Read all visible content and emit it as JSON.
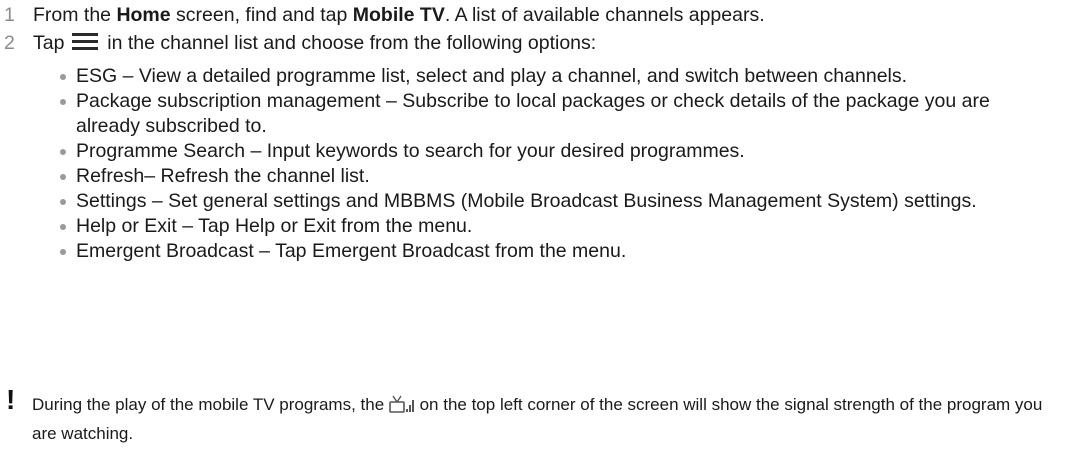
{
  "step1": {
    "number": "1",
    "text_a": "From the ",
    "bold_home": "Home",
    "text_b": " screen, find and tap ",
    "bold_app": "Mobile TV",
    "text_c": ". A list of available channels appears."
  },
  "step2": {
    "number": "2",
    "text_a": "Tap",
    "icon": "menu-icon",
    "text_b": "in the channel list and choose from the following options:"
  },
  "options": [
    {
      "text": "ESG – View a detailed programme list, select and play a channel, and switch between channels."
    },
    {
      "text": "Package subscription management – Subscribe to local packages or check details of the package you are already subscribed to."
    },
    {
      "text": "Programme Search – Input keywords to search for your desired programmes."
    },
    {
      "text": "Refresh– Refresh the channel list."
    },
    {
      "text": "Settings – Set general settings and MBBMS (Mobile Broadcast Business Management System) settings."
    },
    {
      "text": "Help or Exit – Tap Help or Exit from the menu."
    },
    {
      "text": "Emergent Broadcast – Tap Emergent Broadcast from the menu."
    }
  ],
  "note": {
    "icon": "exclamation-icon",
    "symbol": "!",
    "text_a": "During the play of the mobile TV programs, the ",
    "status_icon": "tv-signal-icon",
    "text_b": " on the top left corner of the screen will show the signal strength of the program you are watching."
  }
}
